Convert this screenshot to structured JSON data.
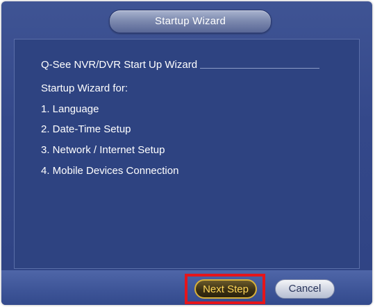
{
  "dialog": {
    "title": "Startup Wizard"
  },
  "content": {
    "heading": "Q-See NVR/DVR Start Up Wizard",
    "intro": "Startup Wizard for:",
    "steps": [
      "1. Language",
      "2. Date-Time Setup",
      "3. Network / Internet Setup",
      "4. Mobile Devices Connection"
    ]
  },
  "footer": {
    "next_label": "Next Step",
    "cancel_label": "Cancel"
  },
  "colors": {
    "background": "#34488a",
    "highlight": "#e5151b",
    "next_text": "#ffd75a"
  }
}
